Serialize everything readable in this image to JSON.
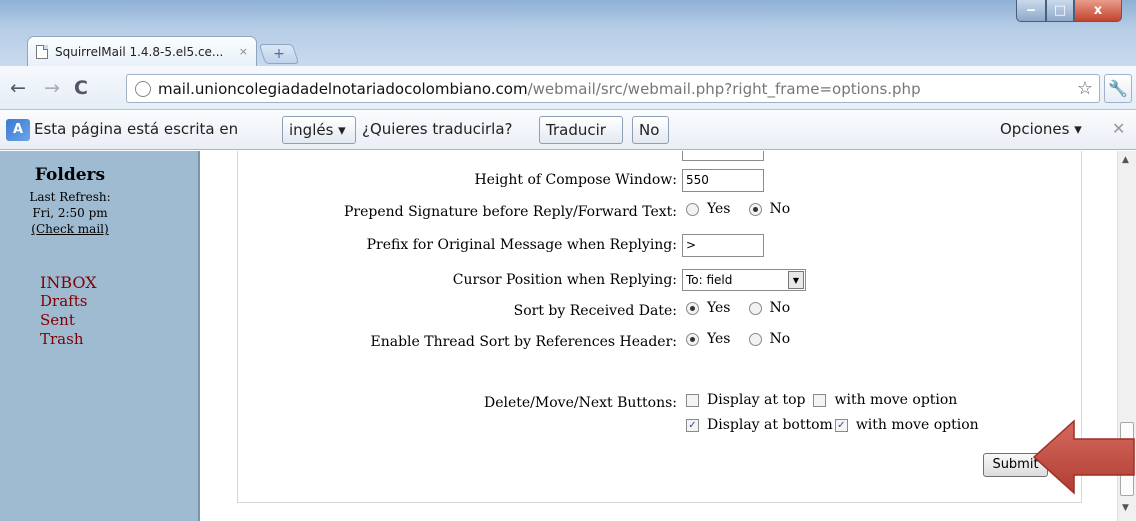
{
  "window": {
    "tab_title": "SquirrelMail 1.4.8-5.el5.ce...",
    "tab_close": "×",
    "new_tab": "+",
    "min": "‒",
    "max": "□",
    "close": "x"
  },
  "toolbar": {
    "back": "←",
    "forward": "→",
    "reload": "C",
    "url_host": "mail.unioncolegiadadelnotariadocolombiano.com",
    "url_path": "/webmail/src/webmail.php?right_frame=options.php",
    "star": "☆",
    "wrench": "🔧"
  },
  "infobar": {
    "icon": "A",
    "message": "Esta página está escrita en",
    "language": "inglés ▾",
    "question": "¿Quieres traducirla?",
    "translate": "Traducir",
    "no": "No",
    "options": "Opciones ▾",
    "close": "✕"
  },
  "folders": {
    "title": "Folders",
    "last_refresh": "Last Refresh:",
    "time": "Fri, 2:50 pm",
    "check_mail": "(Check mail)",
    "items": [
      "INBOX",
      "Drafts",
      "Sent",
      "Trash"
    ]
  },
  "options": {
    "compose_height": {
      "label": "Height of Compose Window:",
      "value": "550"
    },
    "prepend_signature": {
      "label": "Prepend Signature before Reply/Forward Text:",
      "yes": "Yes",
      "no": "No",
      "selected": "No"
    },
    "prefix": {
      "label": "Prefix for Original Message when Replying:",
      "value": ">"
    },
    "cursor_position": {
      "label": "Cursor Position when Replying:",
      "value": "To: field",
      "arrow": "▼"
    },
    "sort_received": {
      "label": "Sort by Received Date:",
      "yes": "Yes",
      "no": "No",
      "selected": "Yes"
    },
    "thread_sort": {
      "label": "Enable Thread Sort by References Header:",
      "yes": "Yes",
      "no": "No",
      "selected": "Yes"
    },
    "delete_move": {
      "label": "Delete/Move/Next Buttons:",
      "display_top": "Display at top",
      "display_top_checked": false,
      "top_move": "with move option",
      "top_move_checked": false,
      "display_bottom": "Display at bottom",
      "display_bottom_checked": true,
      "bottom_move": "with move option",
      "bottom_move_checked": true,
      "checkmark": "✓"
    },
    "submit": "Submit"
  },
  "scrollbar": {
    "up": "▲",
    "down": "▼"
  },
  "colors": {
    "folder_bg": "#9fbbd1",
    "folder_link": "#800000",
    "arrow": "#c0504d"
  }
}
